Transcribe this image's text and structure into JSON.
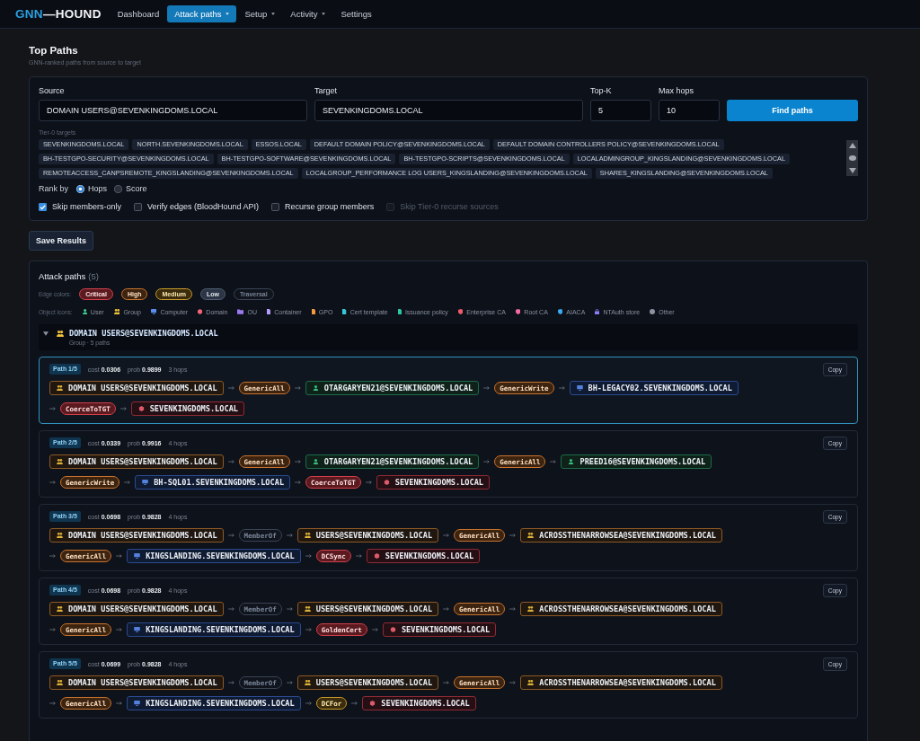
{
  "nav": {
    "brand_accent": "GNN",
    "brand_rest": "—HOUND",
    "items": [
      {
        "label": "Dashboard",
        "selected": false,
        "has_menu": false
      },
      {
        "label": "Attack paths",
        "selected": true,
        "has_menu": true
      },
      {
        "label": "Setup",
        "selected": false,
        "has_menu": true
      },
      {
        "label": "Activity",
        "selected": false,
        "has_menu": true
      },
      {
        "label": "Settings",
        "selected": false,
        "has_menu": false
      }
    ]
  },
  "page": {
    "title": "Top Paths",
    "subtitle": "GNN-ranked paths from source to target"
  },
  "search": {
    "fields": [
      {
        "label": "Source",
        "value": "DOMAIN USERS@SEVENKINGDOMS.LOCAL"
      },
      {
        "label": "Target",
        "value": "SEVENKINGDOMS.LOCAL"
      },
      {
        "label": "Top-K",
        "value": "5"
      },
      {
        "label": "Max hops",
        "value": "10"
      }
    ],
    "submit": "Find paths",
    "tier0_label": "Tier-0 targets",
    "tier0_targets": [
      "SEVENKINGDOMS.LOCAL",
      "NORTH.SEVENKINGDOMS.LOCAL",
      "ESSOS.LOCAL",
      "DEFAULT DOMAIN POLICY@SEVENKINGDOMS.LOCAL",
      "DEFAULT DOMAIN CONTROLLERS POLICY@SEVENKINGDOMS.LOCAL",
      "BH-TESTGPO-SECURITY@SEVENKINGDOMS.LOCAL",
      "BH-TESTGPO-SOFTWARE@SEVENKINGDOMS.LOCAL",
      "BH-TESTGPO-SCRIPTS@SEVENKINGDOMS.LOCAL",
      "LOCALADMINGROUP_KINGSLANDING@SEVENKINGDOMS.LOCAL",
      "REMOTEACCESS_CANPSREMOTE_KINGSLANDING@SEVENKINGDOMS.LOCAL",
      "LOCALGROUP_PERFORMANCE LOG USERS_KINGSLANDING@SEVENKINGDOMS.LOCAL",
      "SHARES_KINGSLANDING@SEVENKINGDOMS.LOCAL"
    ],
    "rank_by": {
      "label": "Rank by",
      "options": [
        {
          "label": "Hops",
          "selected": true
        },
        {
          "label": "Score",
          "selected": false
        }
      ]
    },
    "checkboxes": [
      {
        "label": "Skip members-only",
        "checked": true,
        "disabled": false
      },
      {
        "label": "Verify edges (BloodHound API)",
        "checked": false,
        "disabled": false
      },
      {
        "label": "Recurse group members",
        "checked": false,
        "disabled": false
      },
      {
        "label": "Skip Tier-0 recurse sources",
        "checked": false,
        "disabled": true
      }
    ]
  },
  "save_button": "Save Results",
  "attack_paths": {
    "title": "Attack paths",
    "count": "(5)",
    "edge_legend": {
      "label": "Edge colors:",
      "items": [
        {
          "label": "Critical",
          "kind": "critical"
        },
        {
          "label": "High",
          "kind": "high"
        },
        {
          "label": "Medium",
          "kind": "medium"
        },
        {
          "label": "Low",
          "kind": "low"
        },
        {
          "label": "Traversal",
          "kind": "traversal"
        }
      ]
    },
    "object_legend": {
      "label": "Object icons:",
      "items": [
        {
          "label": "User",
          "kind": "user"
        },
        {
          "label": "Group",
          "kind": "group"
        },
        {
          "label": "Computer",
          "kind": "computer"
        },
        {
          "label": "Domain",
          "kind": "domain"
        },
        {
          "label": "OU",
          "kind": "ou"
        },
        {
          "label": "Container",
          "kind": "container"
        },
        {
          "label": "GPO",
          "kind": "gpo"
        },
        {
          "label": "Cert template",
          "kind": "cert_template"
        },
        {
          "label": "Issuance policy",
          "kind": "issuance_policy"
        },
        {
          "label": "Enterprise CA",
          "kind": "enterprise_ca"
        },
        {
          "label": "Root CA",
          "kind": "root_ca"
        },
        {
          "label": "AIACA",
          "kind": "aiaca"
        },
        {
          "label": "NTAuth store",
          "kind": "ntauth_store"
        },
        {
          "label": "Other",
          "kind": "other"
        }
      ]
    },
    "group": {
      "expanded": true,
      "kind": "group",
      "name": "DOMAIN USERS@SEVENKINGDOMS.LOCAL",
      "meta": "Group · 5 paths"
    },
    "paths": [
      {
        "label": "Path 1/5",
        "cost": "cost **0.0306**",
        "prob": "prob **0.9899**",
        "hops": "3 hops",
        "copy": "Copy",
        "selected": true,
        "source": {
          "kind": "group",
          "label": "DOMAIN USERS@SEVENKINGDOMS.LOCAL"
        },
        "steps": [
          {
            "edge": {
              "label": "GenericAll",
              "kind": "high"
            },
            "node": {
              "kind": "user",
              "label": "OTARGARYEN21@SEVENKINGDOMS.LOCAL"
            }
          },
          {
            "edge": {
              "label": "GenericWrite",
              "kind": "high"
            },
            "node": {
              "kind": "computer",
              "label": "BH-LEGACY02.SEVENKINGDOMS.LOCAL"
            }
          },
          {
            "edge": {
              "label": "CoerceToTGT",
              "kind": "critical"
            },
            "node": {
              "kind": "domain",
              "label": "SEVENKINGDOMS.LOCAL"
            }
          }
        ]
      },
      {
        "label": "Path 2/5",
        "cost": "cost **0.0339**",
        "prob": "prob **0.9916**",
        "hops": "4 hops",
        "copy": "Copy",
        "selected": false,
        "source": {
          "kind": "group",
          "label": "DOMAIN USERS@SEVENKINGDOMS.LOCAL"
        },
        "steps": [
          {
            "edge": {
              "label": "GenericAll",
              "kind": "high"
            },
            "node": {
              "kind": "user",
              "label": "OTARGARYEN21@SEVENKINGDOMS.LOCAL"
            }
          },
          {
            "edge": {
              "label": "GenericAll",
              "kind": "high"
            },
            "node": {
              "kind": "user",
              "label": "PREED16@SEVENKINGDOMS.LOCAL"
            }
          },
          {
            "edge": {
              "label": "GenericWrite",
              "kind": "high"
            },
            "node": {
              "kind": "computer",
              "label": "BH-SQL01.SEVENKINGDOMS.LOCAL"
            }
          },
          {
            "edge": {
              "label": "CoerceToTGT",
              "kind": "critical"
            },
            "node": {
              "kind": "domain",
              "label": "SEVENKINGDOMS.LOCAL"
            }
          }
        ]
      },
      {
        "label": "Path 3/5",
        "cost": "cost **0.0698**",
        "prob": "prob **0.9828**",
        "hops": "4 hops",
        "copy": "Copy",
        "selected": false,
        "source": {
          "kind": "group",
          "label": "DOMAIN USERS@SEVENKINGDOMS.LOCAL"
        },
        "steps": [
          {
            "edge": {
              "label": "MemberOf",
              "kind": "traversal"
            },
            "node": {
              "kind": "group",
              "label": "USERS@SEVENKINGDOMS.LOCAL"
            }
          },
          {
            "edge": {
              "label": "GenericAll",
              "kind": "high"
            },
            "node": {
              "kind": "group",
              "label": "ACROSSTHENARROWSEA@SEVENKINGDOMS.LOCAL"
            }
          },
          {
            "edge": {
              "label": "GenericAll",
              "kind": "high"
            },
            "node": {
              "kind": "computer",
              "label": "KINGSLANDING.SEVENKINGDOMS.LOCAL"
            }
          },
          {
            "edge": {
              "label": "DCSync",
              "kind": "critical"
            },
            "node": {
              "kind": "domain",
              "label": "SEVENKINGDOMS.LOCAL"
            }
          }
        ]
      },
      {
        "label": "Path 4/5",
        "cost": "cost **0.0698**",
        "prob": "prob **0.9828**",
        "hops": "4 hops",
        "copy": "Copy",
        "selected": false,
        "source": {
          "kind": "group",
          "label": "DOMAIN USERS@SEVENKINGDOMS.LOCAL"
        },
        "steps": [
          {
            "edge": {
              "label": "MemberOf",
              "kind": "traversal"
            },
            "node": {
              "kind": "group",
              "label": "USERS@SEVENKINGDOMS.LOCAL"
            }
          },
          {
            "edge": {
              "label": "GenericAll",
              "kind": "high"
            },
            "node": {
              "kind": "group",
              "label": "ACROSSTHENARROWSEA@SEVENKINGDOMS.LOCAL"
            }
          },
          {
            "edge": {
              "label": "GenericAll",
              "kind": "high"
            },
            "node": {
              "kind": "computer",
              "label": "KINGSLANDING.SEVENKINGDOMS.LOCAL"
            }
          },
          {
            "edge": {
              "label": "GoldenCert",
              "kind": "critical"
            },
            "node": {
              "kind": "domain",
              "label": "SEVENKINGDOMS.LOCAL"
            }
          }
        ]
      },
      {
        "label": "Path 5/5",
        "cost": "cost **0.0699**",
        "prob": "prob **0.9828**",
        "hops": "4 hops",
        "copy": "Copy",
        "selected": false,
        "source": {
          "kind": "group",
          "label": "DOMAIN USERS@SEVENKINGDOMS.LOCAL"
        },
        "steps": [
          {
            "edge": {
              "label": "MemberOf",
              "kind": "traversal"
            },
            "node": {
              "kind": "group",
              "label": "USERS@SEVENKINGDOMS.LOCAL"
            }
          },
          {
            "edge": {
              "label": "GenericAll",
              "kind": "high"
            },
            "node": {
              "kind": "group",
              "label": "ACROSSTHENARROWSEA@SEVENKINGDOMS.LOCAL"
            }
          },
          {
            "edge": {
              "label": "GenericAll",
              "kind": "high"
            },
            "node": {
              "kind": "computer",
              "label": "KINGSLANDING.SEVENKINGDOMS.LOCAL"
            }
          },
          {
            "edge": {
              "label": "DCFor",
              "kind": "medium"
            },
            "node": {
              "kind": "domain",
              "label": "SEVENKINGDOMS.LOCAL"
            }
          }
        ]
      }
    ]
  }
}
